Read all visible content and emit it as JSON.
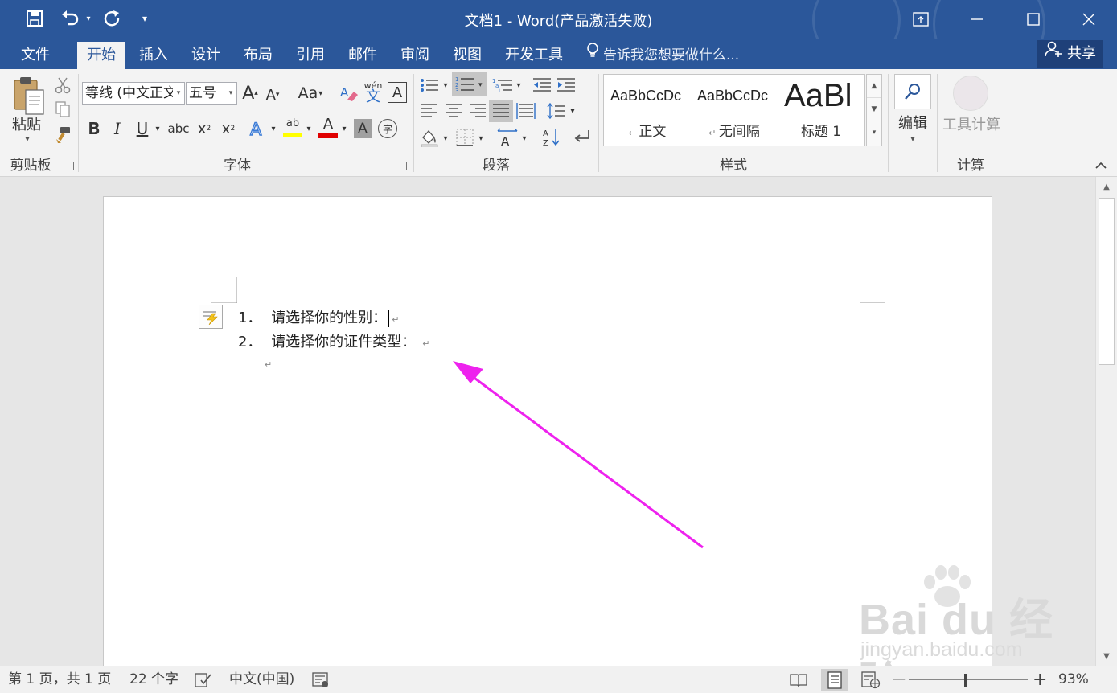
{
  "window": {
    "title": "文档1 - Word(产品激活失败)",
    "accent": "#2b579a"
  },
  "qat": {
    "save_icon": "save-icon",
    "undo_icon": "undo-icon",
    "redo_icon": "repeat-icon",
    "customize_icon": "customize-qat-icon"
  },
  "menu": {
    "tabs": [
      "文件",
      "开始",
      "插入",
      "设计",
      "布局",
      "引用",
      "邮件",
      "审阅",
      "视图",
      "开发工具"
    ],
    "active": "开始",
    "tell_me": "告诉我您想要做什么...",
    "share": "共享"
  },
  "ribbon": {
    "clipboard": {
      "label": "剪贴板",
      "paste": "粘贴"
    },
    "font": {
      "label": "字体",
      "font_name": "等线 (中文正文",
      "font_size": "五号",
      "change_case": "Aa",
      "phonetic_top": "wén",
      "phonetic_bottom": "文",
      "bold": "B",
      "italic": "I",
      "underline": "U",
      "strikethrough": "abc",
      "subscript": "x",
      "superscript": "x",
      "highlight_text": "ab",
      "font_color_text": "A",
      "enclose_char": "字",
      "highlight_color": "#ffff00",
      "font_color": "#e00000"
    },
    "paragraph": {
      "label": "段落"
    },
    "styles": {
      "label": "样式",
      "items": [
        {
          "preview": "AaBbCcDc",
          "name": "正文"
        },
        {
          "preview": "AaBbCcDc",
          "name": "无间隔"
        },
        {
          "preview": "AaBl",
          "name": "标题 1"
        }
      ]
    },
    "editing": {
      "label": "编辑"
    },
    "calc": {
      "label": "计算",
      "tool": "工具计算"
    }
  },
  "document": {
    "lines": [
      {
        "number": "1．",
        "text": "请选择你的性别："
      },
      {
        "number": "2．",
        "text": "请选择你的证件类型："
      }
    ],
    "para_mark": "↵",
    "arrow_color": "#ee22ee"
  },
  "watermark": {
    "brand": "Bai du 经验",
    "url": "jingyan.baidu.com"
  },
  "status": {
    "page": "第 1 页，共 1 页",
    "words": "22 个字",
    "language": "中文(中国)",
    "zoom": "93%",
    "zoom_minus": "－",
    "zoom_plus": "+"
  }
}
